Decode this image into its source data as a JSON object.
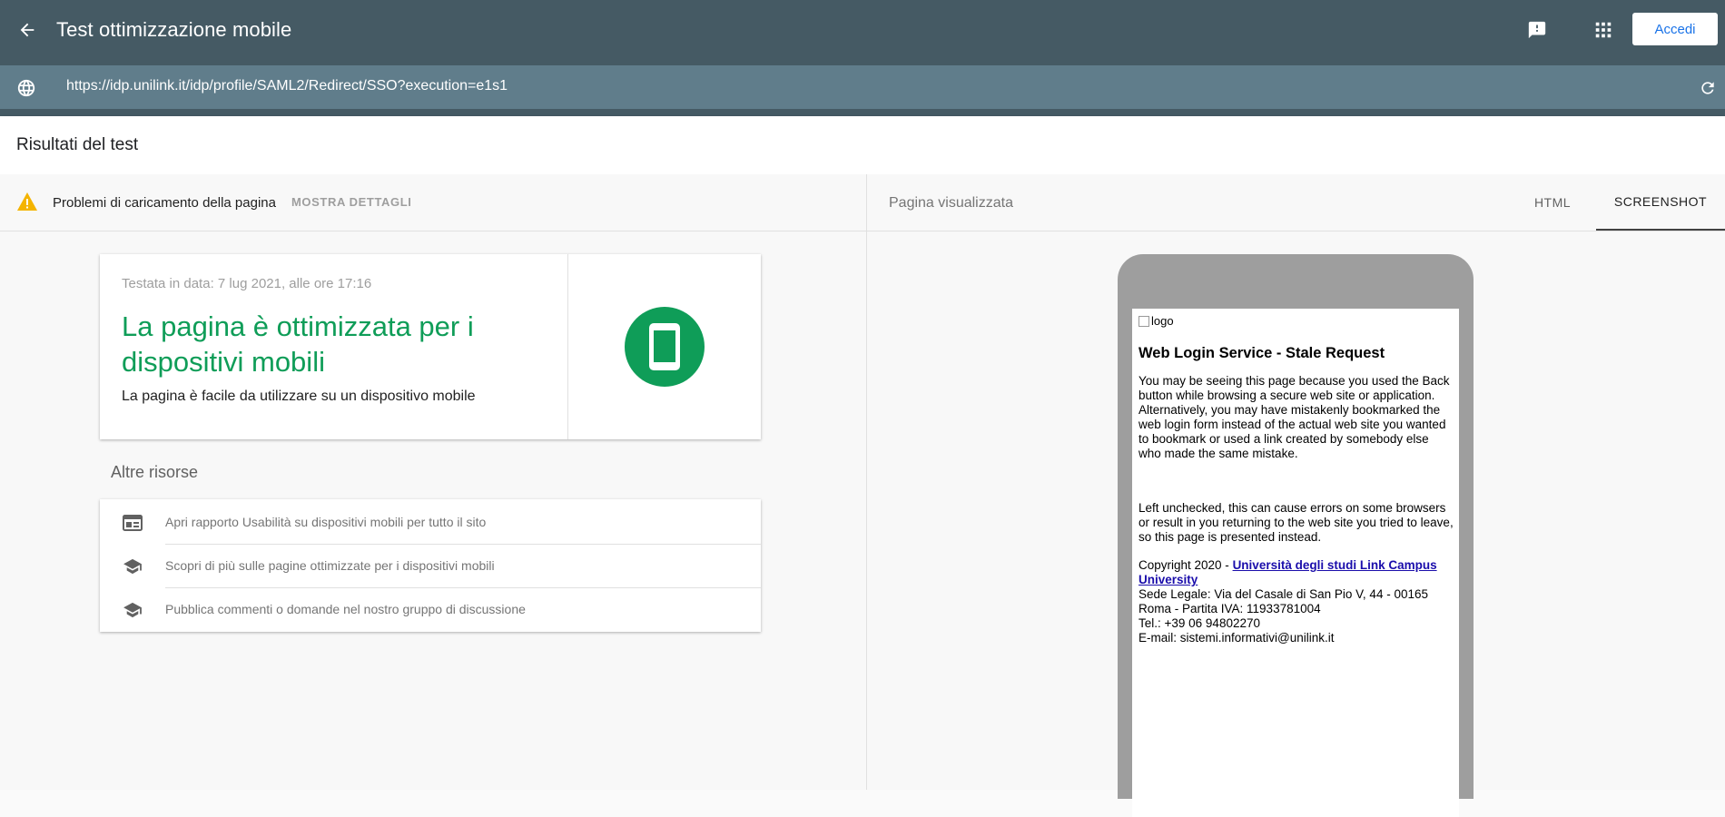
{
  "appbar": {
    "title": "Test ottimizzazione mobile",
    "signin_label": "Accedi",
    "icons": [
      "arrow-back-icon",
      "feedback-icon",
      "apps-grid-icon"
    ]
  },
  "urlbar": {
    "url": "https://idp.unilink.it/idp/profile/SAML2/Redirect/SSO?execution=e1s1",
    "icons": [
      "globe-icon",
      "reload-icon"
    ]
  },
  "results": {
    "title": "Risultati del test"
  },
  "issues": {
    "text": "Problemi di caricamento della pagina",
    "details_label": "MOSTRA DETTAGLI"
  },
  "verdict": {
    "date": "Testata in data: 7 lug 2021, alle ore 17:16",
    "headline": "La pagina è ottimizzata per i dispositivi mobili",
    "subtitle": "La pagina è facile da utilizzare su un dispositivo mobile",
    "status_color": "#0f9d58"
  },
  "resources": {
    "title": "Altre risorse",
    "items": [
      {
        "icon": "web-report-icon",
        "label": "Apri rapporto Usabilità su dispositivi mobili per tutto il sito"
      },
      {
        "icon": "school-cap-icon",
        "label": "Scopri di più sulle pagine ottimizzate per i dispositivi mobili"
      },
      {
        "icon": "school-cap-icon",
        "label": "Pubblica commenti o domande nel nostro gruppo di discussione"
      }
    ]
  },
  "rendered": {
    "title": "Pagina visualizzata",
    "tabs": [
      "HTML",
      "SCREENSHOT"
    ],
    "active_tab": "SCREENSHOT",
    "screenshot": {
      "logo_alt": "logo",
      "heading": "Web Login Service - Stale Request",
      "para1": "You may be seeing this page because you used the Back button while browsing a secure web site or application. Alternatively, you may have mistakenly bookmarked the web login form instead of the actual web site you wanted to bookmark or used a link created by somebody else who made the same mistake.",
      "para2": "Left unchecked, this can cause errors on some browsers or result in you returning to the web site you tried to leave, so this page is presented instead.",
      "copyright_prefix": "Copyright 2020 - ",
      "copyright_link": "Università degli studi Link Campus University",
      "address": "Sede Legale: Via del Casale di San Pio V, 44 - 00165 Roma - Partita IVA: 11933781004",
      "tel": "Tel.: +39 06 94802270",
      "email": "E-mail: sistemi.informativi@unilink.it"
    }
  },
  "colors": {
    "appbar": "#455a64",
    "urlbar": "#607d8b",
    "accent_blue": "#1a73e8",
    "warning": "#f4b400"
  }
}
